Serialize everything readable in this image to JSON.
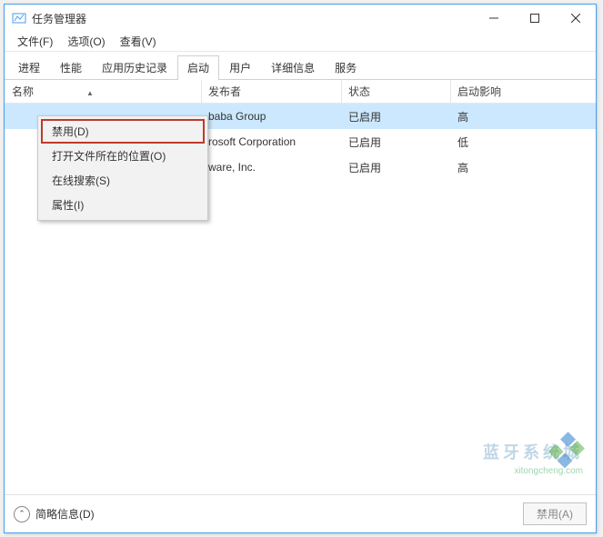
{
  "window": {
    "title": "任务管理器"
  },
  "winControls": {
    "min": "minimize",
    "max": "maximize",
    "close": "close"
  },
  "menubar": [
    "文件(F)",
    "选项(O)",
    "查看(V)"
  ],
  "tabs": [
    {
      "label": "进程",
      "active": false
    },
    {
      "label": "性能",
      "active": false
    },
    {
      "label": "应用历史记录",
      "active": false
    },
    {
      "label": "启动",
      "active": true
    },
    {
      "label": "用户",
      "active": false
    },
    {
      "label": "详细信息",
      "active": false
    },
    {
      "label": "服务",
      "active": false
    }
  ],
  "columns": {
    "name": "名称",
    "publisher": "发布者",
    "status": "状态",
    "impact": "启动影响"
  },
  "rows": [
    {
      "publisher_partial": "baba Group",
      "status": "已启用",
      "impact": "高",
      "selected": true
    },
    {
      "publisher_partial": "rosoft Corporation",
      "status": "已启用",
      "impact": "低",
      "selected": false
    },
    {
      "publisher_partial": "ware, Inc.",
      "status": "已启用",
      "impact": "高",
      "selected": false
    }
  ],
  "contextMenu": {
    "items": [
      {
        "label": "禁用(D)",
        "highlight": true
      },
      {
        "label": "打开文件所在的位置(O)",
        "highlight": false
      },
      {
        "label": "在线搜索(S)",
        "highlight": false
      },
      {
        "label": "属性(I)",
        "highlight": false
      }
    ]
  },
  "footer": {
    "brief": "简略信息(D)",
    "disable": "禁用(A)"
  },
  "watermark": {
    "url": "xitongcheng.com",
    "cn": "蓝牙系统城"
  }
}
